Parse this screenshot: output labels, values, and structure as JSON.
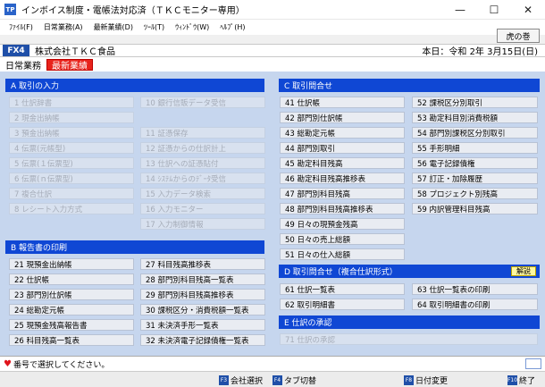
{
  "window": {
    "title": "インボイス制度・電帳法対応済（ＴＫＣモニター専用）",
    "icon_label": "TP",
    "minimize": "—",
    "maximize": "☐",
    "close": "✕"
  },
  "menu": [
    "ﾌｧｲﾙ(F)",
    "日常業務(A)",
    "最新業績(D)",
    "ﾂｰﾙ(T)",
    "ｳｨﾝﾄﾞｳ(W)",
    "ﾍﾙﾌﾟ(H)"
  ],
  "tora_button": "虎の巻",
  "company_bar": {
    "badge": "FX4",
    "company": "株式会社ＴＫＣ食品",
    "today": "本日：令和 2年 3月15日(日)"
  },
  "tabs": {
    "daily": "日常業務",
    "latest": "最新業績"
  },
  "sections": {
    "A": {
      "header": "A 取引の入力",
      "left": [
        {
          "label": "1 仕訳辞書",
          "enabled": false
        },
        {
          "label": "2 現金出納帳",
          "enabled": false
        },
        {
          "label": "3 預金出納帳",
          "enabled": false
        },
        {
          "label": "4 伝票(元帳型)",
          "enabled": false
        },
        {
          "label": "5 伝票(１伝票型)",
          "enabled": false
        },
        {
          "label": "6 伝票(ｎ伝票型)",
          "enabled": false
        },
        {
          "label": "7 複合仕訳",
          "enabled": false
        },
        {
          "label": "8 レシート入力方式",
          "enabled": false
        }
      ],
      "right_top": [
        {
          "label": "10 銀行信販データ受信",
          "enabled": false
        }
      ],
      "right": [
        {
          "label": "11 証憑保存",
          "enabled": false
        },
        {
          "label": "12 証憑からの仕訳計上",
          "enabled": false
        },
        {
          "label": "13 仕訳への証憑貼付",
          "enabled": false
        },
        {
          "label": "14 ｼｽﾃﾑからのﾃﾞｰﾀ受信",
          "enabled": false
        },
        {
          "label": "15 入力データ検索",
          "enabled": false
        },
        {
          "label": "16 入力モニター",
          "enabled": false
        },
        {
          "label": "17 入力制御情報",
          "enabled": false
        }
      ]
    },
    "B": {
      "header": "B 報告書の印刷",
      "left": [
        "21 現預金出納帳",
        "22 仕訳帳",
        "23 部門別仕訳帳",
        "24 総勘定元帳",
        "25 現預金残高報告書",
        "26 科目残高一覧表"
      ],
      "right": [
        "27 科目残高推移表",
        "28 部門別科目残高一覧表",
        "29 部門別科目残高推移表",
        "30 課税区分・消費税額一覧表",
        "31 未決済手形一覧表",
        "32 未決済電子記録債権一覧表"
      ]
    },
    "C": {
      "header": "C 取引問合せ",
      "left": [
        "41 仕訳帳",
        "42 部門別仕訳帳",
        "43 総勘定元帳",
        "44 部門別取引",
        "45 勘定科目残高",
        "46 勘定科目残高推移表",
        "47 部門別科目残高",
        "48 部門別科目残高推移表",
        "49 日々の現預金残高",
        "50 日々の売上総額",
        "51 日々の仕入総額"
      ],
      "right": [
        "52 課税区分別取引",
        "53 勘定科目別消費税額",
        "54 部門別課税区分別取引",
        "55 手形明細",
        "56 電子記録債権",
        "57 訂正・加除履歴",
        "58 プロジェクト別残高",
        "59 内訳管理科目残高"
      ]
    },
    "D": {
      "header": "D 取引問合せ（複合仕訳形式）",
      "help": "解説",
      "left": [
        "61 仕訳一覧表",
        "62 取引明細書"
      ],
      "right": [
        "63 仕訳一覧表の印刷",
        "64 取引明細書の印刷"
      ]
    },
    "E": {
      "header": "E 仕訳の承認",
      "items": [
        {
          "label": "71 仕訳の承認",
          "enabled": false
        }
      ]
    }
  },
  "status": {
    "icon": "♥",
    "text": "番号で選択してください。"
  },
  "fkeys": [
    {
      "key": "F3",
      "label": "会社選択"
    },
    {
      "key": "F4",
      "label": "タブ切替"
    },
    {
      "key": "F8",
      "label": "日付変更"
    },
    {
      "key": "F10",
      "label": "終了"
    }
  ]
}
